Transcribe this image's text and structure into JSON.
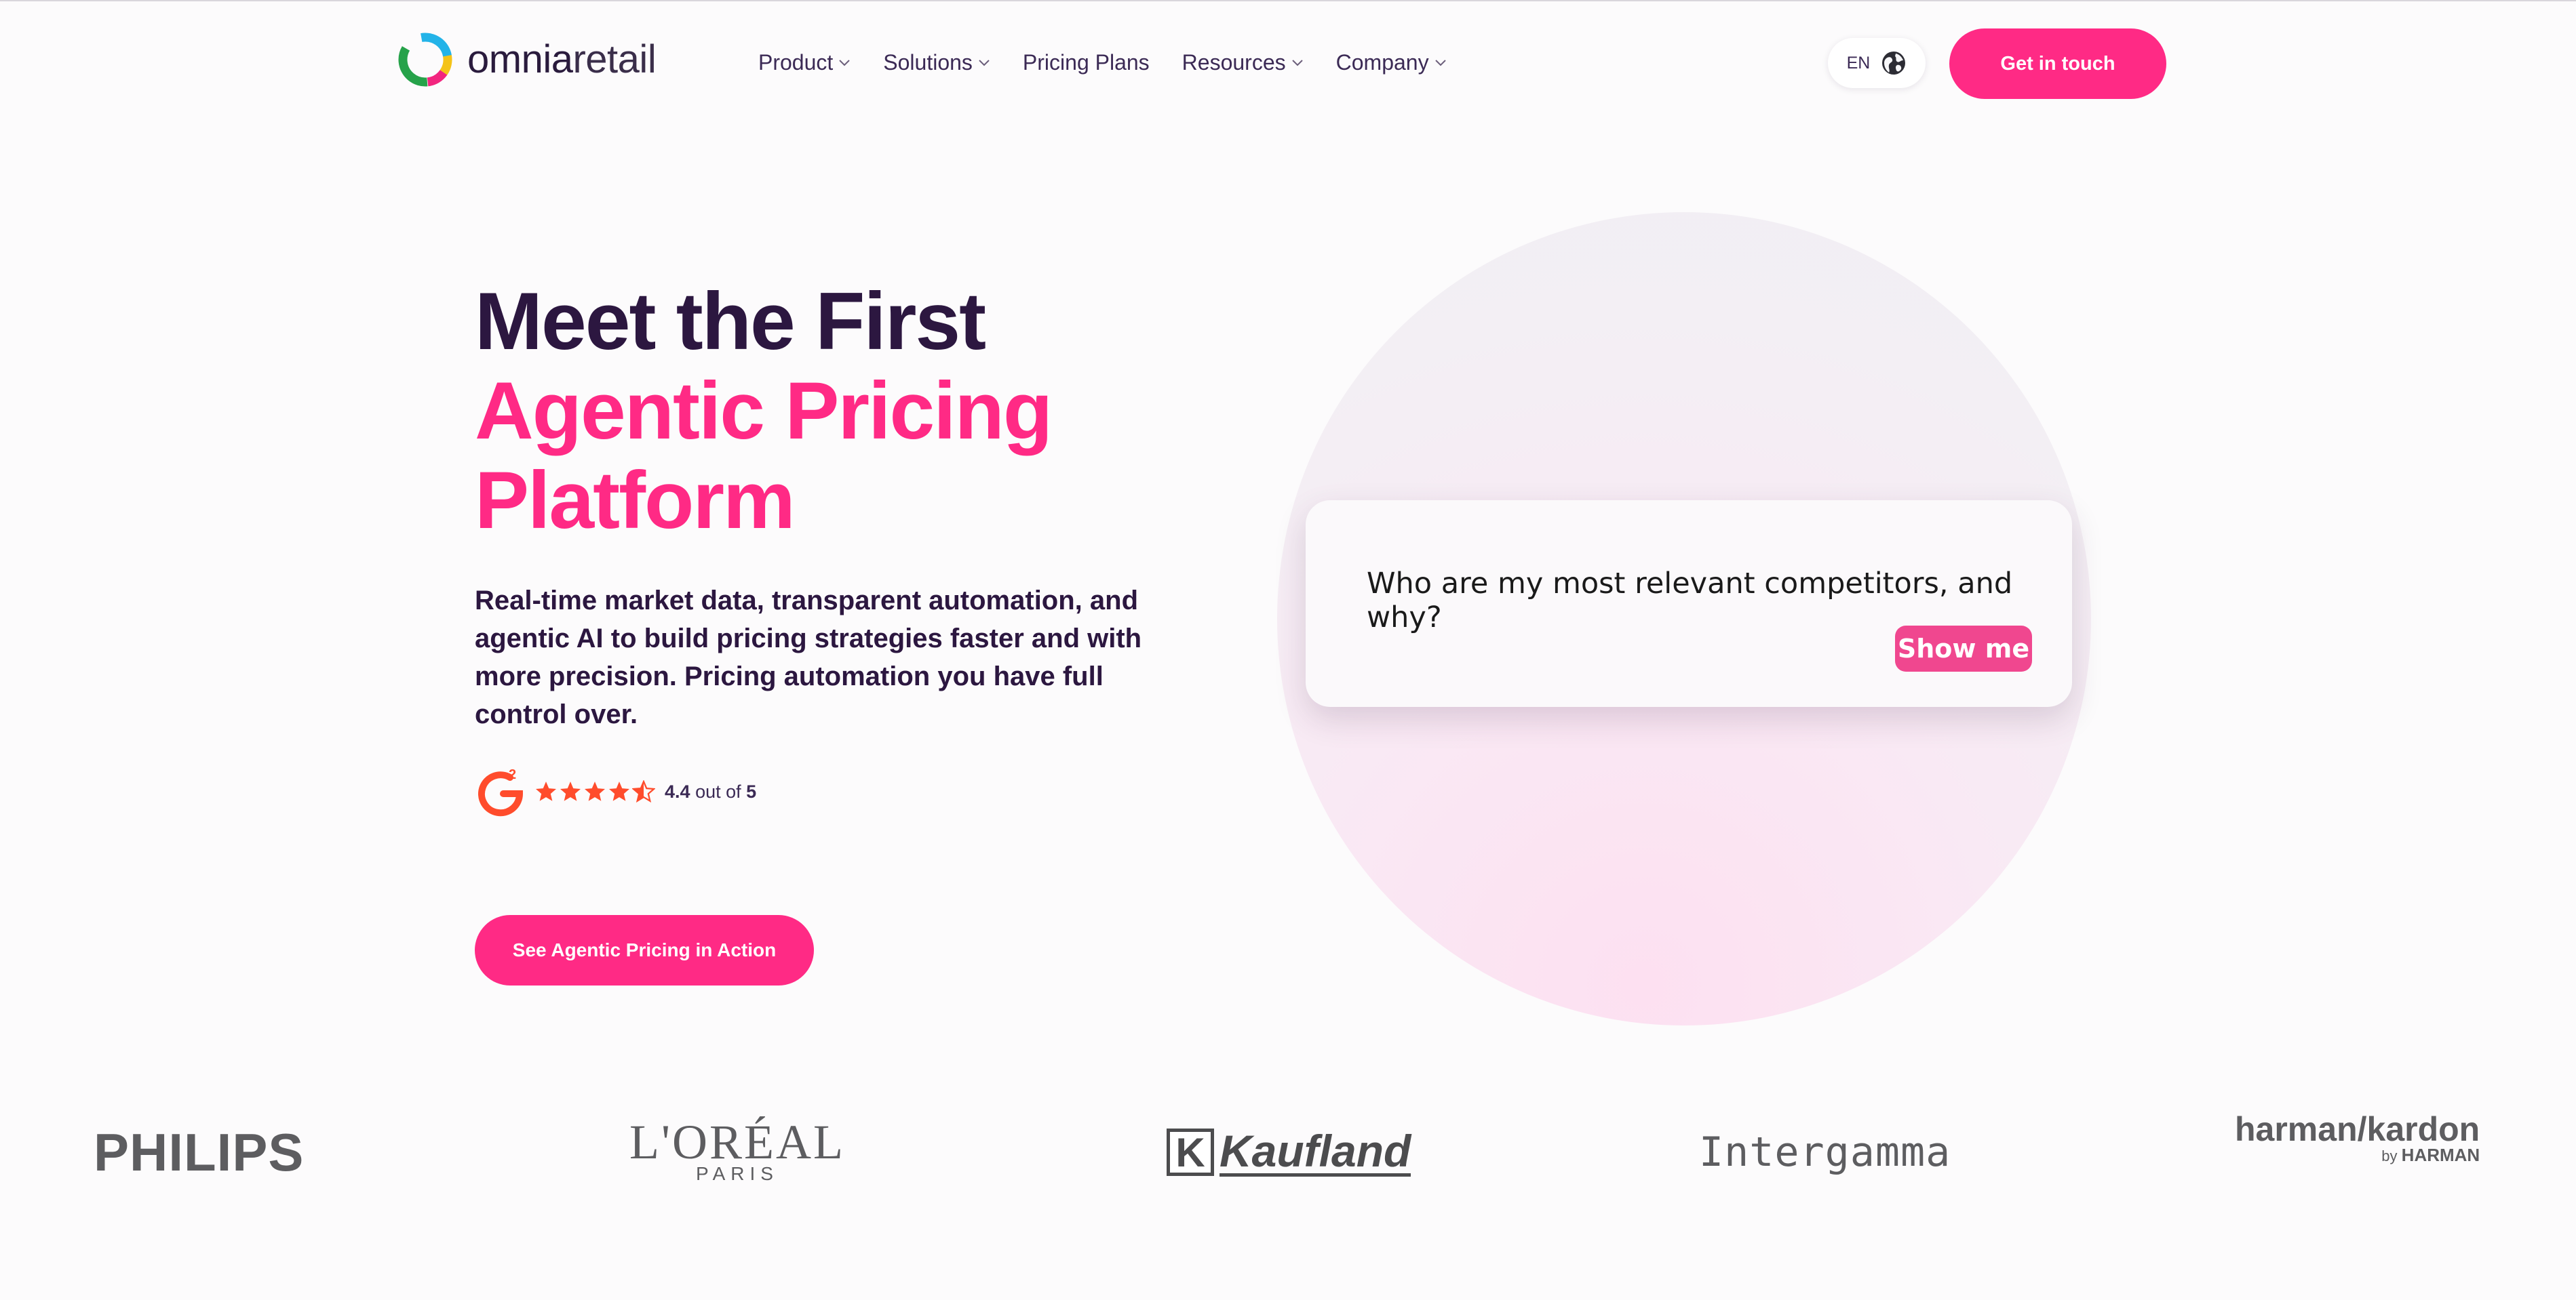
{
  "brand": {
    "name_bold": "omnia",
    "name_light": "retail"
  },
  "nav": {
    "items": [
      {
        "label": "Product",
        "has_dropdown": true
      },
      {
        "label": "Solutions",
        "has_dropdown": true
      },
      {
        "label": "Pricing Plans",
        "has_dropdown": false
      },
      {
        "label": "Resources",
        "has_dropdown": true
      },
      {
        "label": "Company",
        "has_dropdown": true
      }
    ],
    "language": "EN",
    "language_icon": "globe-icon",
    "cta_label": "Get in touch"
  },
  "hero": {
    "title_line1": "Meet the First",
    "title_line2": "Agentic Pricing",
    "title_line3": "Platform",
    "subtitle": "Real-time market data, transparent automation, and agentic AI to build pricing strategies faster and with more precision. Pricing automation you have full control over.",
    "rating": {
      "source_icon": "g2-logo-icon",
      "stars": 4.5,
      "score": "4.4",
      "out_of_text": "out of",
      "max": "5"
    },
    "cta_label": "See Agentic Pricing in Action"
  },
  "prompt_card": {
    "question": "Who are my most relevant competitors, and why?",
    "button_label": "Show me"
  },
  "client_logos": {
    "philips": "PHILIPS",
    "loreal_main": "L'ORÉAL",
    "loreal_sub": "PARIS",
    "kaufland_mark": "K",
    "kaufland_word": "Kaufland",
    "intergamma": "Intergamma",
    "harman_main": "harman/kardon",
    "harman_by": "by",
    "harman_sub": "HARMAN"
  },
  "colors": {
    "accent": "#ff2a85",
    "heading": "#2c1740",
    "logo_gray": "#5d5d60"
  }
}
